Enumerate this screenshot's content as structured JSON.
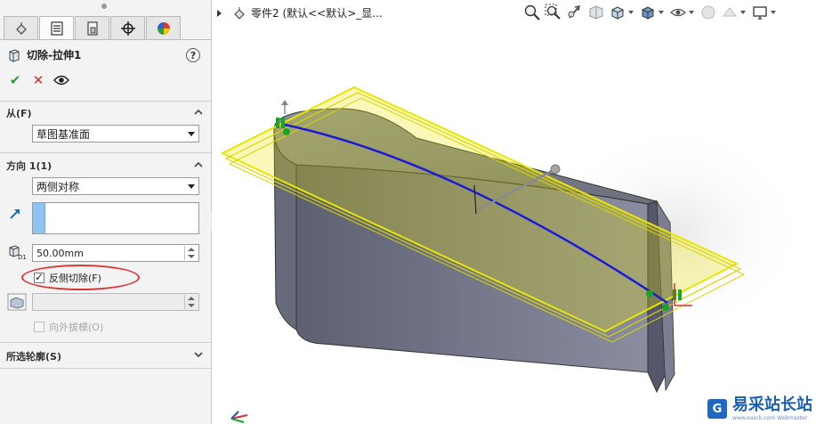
{
  "property_manager": {
    "tabs": [
      {
        "name": "feature-manager",
        "icon": "feature-tree-icon"
      },
      {
        "name": "property-manager",
        "icon": "property-manager-icon"
      },
      {
        "name": "configuration-manager",
        "icon": "configuration-icon"
      },
      {
        "name": "dimxpert-manager",
        "icon": "crosshair-icon"
      },
      {
        "name": "display-manager",
        "icon": "appearance-pie-icon"
      }
    ],
    "active_tab": 1,
    "feature_title": "切除-拉伸1",
    "help": "?",
    "from_group": {
      "label": "从(F)",
      "selected": "草图基准面"
    },
    "direction1_group": {
      "label": "方向 1(1)",
      "end_condition": "两侧对称",
      "depth_value": "50.00mm",
      "depth_icon_label": "D1",
      "flip_side_to_cut": {
        "label": "反侧切除(F)",
        "checked": true
      },
      "draft_outward": {
        "label": "向外拔模(O)",
        "checked": false,
        "enabled": false
      }
    },
    "selected_contours_group": {
      "label": "所选轮廓(S)"
    }
  },
  "graphics": {
    "tree_header": "零件2  (默认<<默认>_显...",
    "hud_icons": [
      "zoom-to-fit-icon",
      "zoom-area-icon",
      "previous-view-icon",
      "section-view-icon",
      "view-orientation-icon",
      "display-style-icon",
      "hide-show-icon",
      "edit-appearance-icon",
      "apply-scene-icon",
      "view-settings-icon"
    ]
  },
  "watermark": {
    "logo_letter": "G",
    "text": "易采站长站",
    "sub": "www.easck.com  Webmaster"
  },
  "colors": {
    "accept": "#2e9d2e",
    "cancel": "#d33030",
    "highlight_ellipse": "#d63a3a",
    "preview_plane": "#e9e600",
    "sketch_curve": "#1a1ad8",
    "body": "#6f7282"
  }
}
